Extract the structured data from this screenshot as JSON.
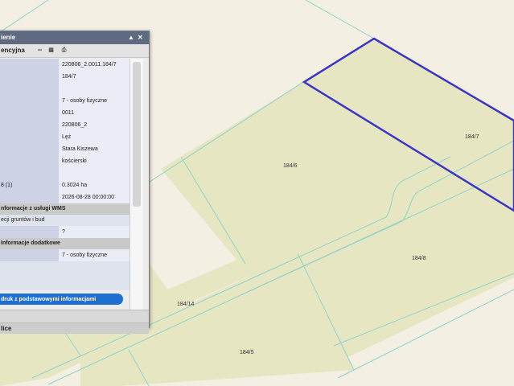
{
  "map": {
    "parcel_labels": [
      "184/7",
      "184/6",
      "184/8",
      "184/14",
      "184/5"
    ],
    "colors": {
      "background": "#f4efe3",
      "parcel_fill": "#e6e6c3",
      "boundary": "#8fd3c8",
      "selection": "#3a35c8"
    }
  },
  "panel": {
    "title": "ienie",
    "subtitle": "encyjna",
    "rows": [
      {
        "label": "",
        "value": "220806_2.0011.184/7"
      },
      {
        "label": "",
        "value": "184/7"
      },
      {
        "label": "",
        "value": ""
      },
      {
        "label": "",
        "value": "7 - osoby fizyczne"
      },
      {
        "label": "",
        "value": "0011"
      },
      {
        "label": "",
        "value": "220806_2"
      },
      {
        "label": "",
        "value": "Lęż"
      },
      {
        "label": "",
        "value": "Stara Kiszewa"
      },
      {
        "label": "",
        "value": "kościerski"
      },
      {
        "label": "",
        "value": ""
      },
      {
        "label": "8 (1)",
        "value": "0.3024 ha"
      },
      {
        "label": "",
        "value": "2026-08-28 00:00:00"
      }
    ],
    "section_1": "nformacje z usługi WMS",
    "section_1_row": "ecji gruntów i bud",
    "section_1_value": "?",
    "section_2": "Informacje dodatkowe",
    "section_2_value": "7 - osoby fizyczne",
    "print_button": "druk z podstawowymi informacjami",
    "collapsed_1": "",
    "collapsed_2": "lice"
  }
}
